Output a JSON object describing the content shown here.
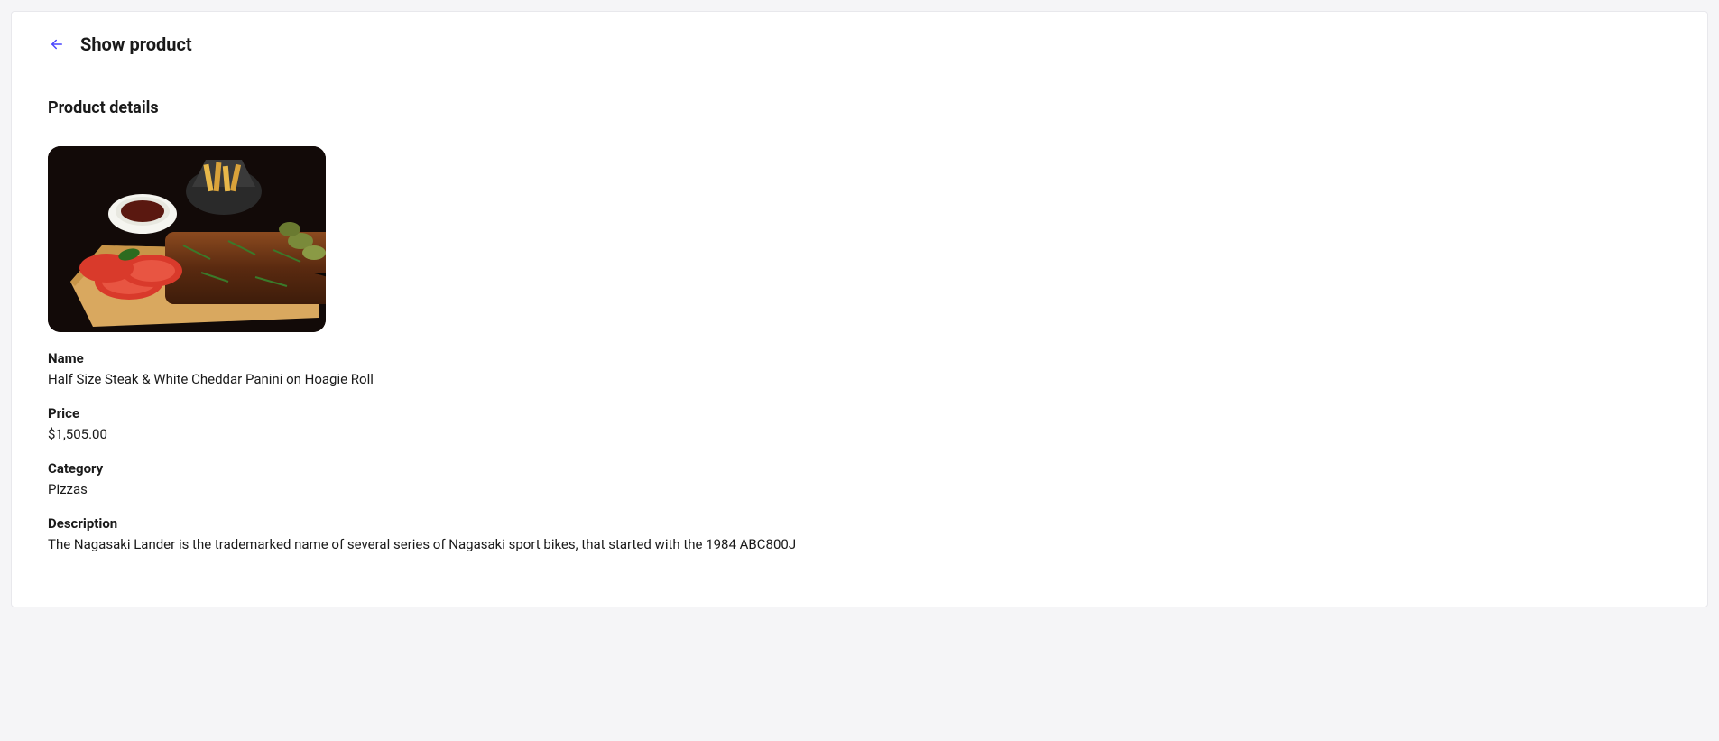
{
  "header": {
    "title": "Show product"
  },
  "section": {
    "title": "Product details"
  },
  "product": {
    "fields": {
      "name": {
        "label": "Name",
        "value": "Half Size Steak & White Cheddar Panini on Hoagie Roll"
      },
      "price": {
        "label": "Price",
        "value": "$1,505.00"
      },
      "category": {
        "label": "Category",
        "value": "Pizzas"
      },
      "description": {
        "label": "Description",
        "value": "The Nagasaki Lander is the trademarked name of several series of Nagasaki sport bikes, that started with the 1984 ABC800J"
      }
    }
  }
}
